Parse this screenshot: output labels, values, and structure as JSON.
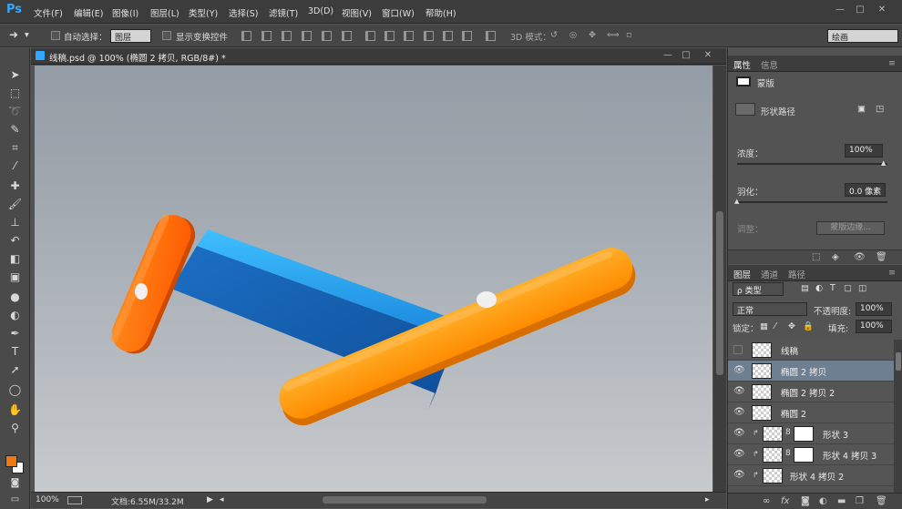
{
  "app": {
    "logo": "Ps",
    "menu": [
      "文件(F)",
      "编辑(E)",
      "图像(I)",
      "图层(L)",
      "类型(Y)",
      "选择(S)",
      "滤镜(T)",
      "3D(D)",
      "视图(V)",
      "窗口(W)",
      "帮助(H)"
    ],
    "window_controls": [
      "—",
      "□",
      "✕"
    ]
  },
  "options_bar": {
    "auto_select_label": "自动选择：",
    "auto_select_value": "图层",
    "show_transform_label": "显示变换控件",
    "mode_3d_label": "3D 模式：",
    "workspace_value": "绘画"
  },
  "document": {
    "title": "线稿.psd @ 100% (椭圆 2 拷贝, RGB/8#) *",
    "zoom": "100%",
    "doc_size": "文档:6.55M/33.2M",
    "controls": [
      "—",
      "□",
      "✕"
    ]
  },
  "properties_panel": {
    "tabs": [
      "属性",
      "信息"
    ],
    "mask_label": "蒙版",
    "shape_path_label": "形状路径",
    "density_label": "浓度：",
    "density_value": "100%",
    "density_level": 1.0,
    "feather_label": "羽化：",
    "feather_value": "0.0 像素",
    "feather_level": 0.0,
    "adjust_label": "调整：",
    "mask_edge_button": "蒙版边缘..."
  },
  "layers_panel": {
    "tabs": [
      "图层",
      "通道",
      "路径"
    ],
    "filter_value": "ρ 类型",
    "blend_mode": "正常",
    "opacity_label": "不透明度:",
    "opacity_value": "100%",
    "lock_label": "锁定：",
    "fill_label": "填充:",
    "fill_value": "100%",
    "layers": [
      {
        "name": "线稿",
        "visible": false,
        "selected": false
      },
      {
        "name": "椭圆 2 拷贝",
        "visible": true,
        "selected": true
      },
      {
        "name": "椭圆 2 拷贝 2",
        "visible": true,
        "selected": false
      },
      {
        "name": "椭圆 2",
        "visible": true,
        "selected": false
      },
      {
        "name": "形状 3",
        "visible": true,
        "selected": false
      },
      {
        "name": "形状 4 拷贝 3",
        "visible": true,
        "selected": false
      },
      {
        "name": "形状 4 拷贝 2",
        "visible": true,
        "selected": false
      }
    ],
    "bottom_icons": [
      "link-icon",
      "fx-icon",
      "mask-icon",
      "adjustment-icon",
      "folder-icon",
      "new-layer-icon",
      "trash-icon"
    ]
  },
  "colors": {
    "foreground": "#f07a12",
    "background": "#ffffff",
    "handle_blue": "#1f8fe0",
    "handle_orange": "#ff6a00",
    "handle_gold": "#ffa020"
  }
}
